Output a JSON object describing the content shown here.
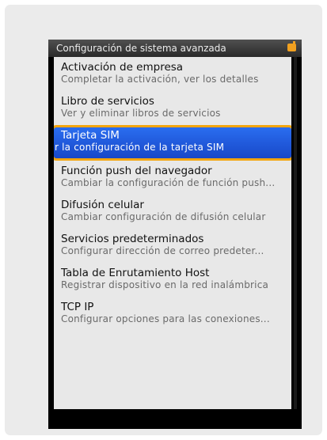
{
  "screen": {
    "title": "Configuración de sistema avanzada"
  },
  "menu": {
    "items": [
      {
        "title": "Activación de empresa",
        "subtitle": "Completar la activación, ver los detalles",
        "selected": false
      },
      {
        "title": "Libro de servicios",
        "subtitle": "Ver y eliminar libros de servicios",
        "selected": false
      },
      {
        "title": "Tarjeta SIM",
        "subtitle": "r la configuración de la tarjeta SIM",
        "selected": true
      },
      {
        "title": "Función push del navegador",
        "subtitle": "Cambiar la configuración de función push...",
        "selected": false
      },
      {
        "title": "Difusión celular",
        "subtitle": "Cambiar configuración de difusión celular",
        "selected": false
      },
      {
        "title": "Servicios predeterminados",
        "subtitle": "Configurar dirección de correo predeter...",
        "selected": false
      },
      {
        "title": "Tabla de Enrutamiento Host",
        "subtitle": "Registrar dispositivo en la red inalámbrica",
        "selected": false
      },
      {
        "title": "TCP IP",
        "subtitle": "Configurar opciones para las conexiones...",
        "selected": false
      }
    ]
  },
  "icons": {
    "battery": "battery-icon"
  },
  "colors": {
    "highlight": "#1c56de",
    "highlight_border": "#f4a50c",
    "list_background": "#e8e8e8"
  }
}
